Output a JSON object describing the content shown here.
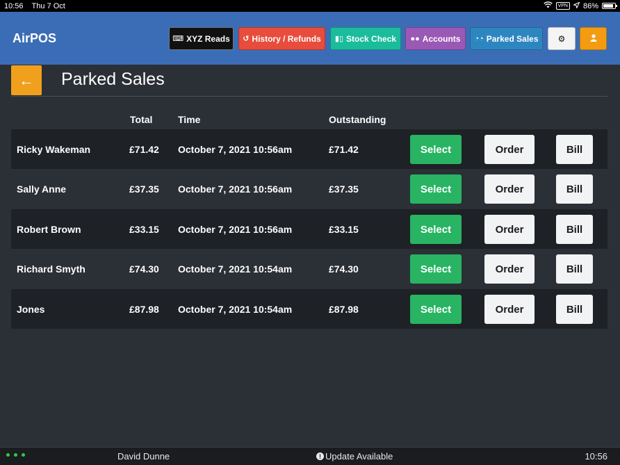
{
  "status_bar": {
    "time": "10:56",
    "date": "Thu 7 Oct",
    "vpn": "VPN",
    "battery": "86%",
    "battery_level": 0.86
  },
  "header": {
    "brand": "AirPOS",
    "nav": {
      "xyz_reads": "XYZ Reads",
      "history_refunds": "History / Refunds",
      "stock_check": "Stock Check",
      "accounts": "Accounts",
      "parked_sales": "Parked Sales"
    }
  },
  "page": {
    "back_icon": "arrow-left-icon",
    "title": "Parked Sales"
  },
  "table": {
    "headers": {
      "name": "",
      "total": "Total",
      "time": "Time",
      "outstanding": "Outstanding"
    },
    "rows": [
      {
        "name": "Ricky Wakeman",
        "total": "£71.42",
        "time": "October 7, 2021 10:56am",
        "outstanding": "£71.42",
        "select": "Select",
        "order": "Order",
        "bill": "Bill"
      },
      {
        "name": "Sally Anne",
        "total": "£37.35",
        "time": "October 7, 2021 10:56am",
        "outstanding": "£37.35",
        "select": "Select",
        "order": "Order",
        "bill": "Bill"
      },
      {
        "name": "Robert Brown",
        "total": "£33.15",
        "time": "October 7, 2021 10:56am",
        "outstanding": "£33.15",
        "select": "Select",
        "order": "Order",
        "bill": "Bill"
      },
      {
        "name": "Richard Smyth",
        "total": "£74.30",
        "time": "October 7, 2021 10:54am",
        "outstanding": "£74.30",
        "select": "Select",
        "order": "Order",
        "bill": "Bill"
      },
      {
        "name": "Jones",
        "total": "£87.98",
        "time": "October 7, 2021 10:54am",
        "outstanding": "£87.98",
        "select": "Select",
        "order": "Order",
        "bill": "Bill"
      }
    ]
  },
  "footer": {
    "user": "David Dunne",
    "update": "Update Available",
    "time": "10:56"
  },
  "colors": {
    "header_bg": "#3b6db6",
    "xyz_reads": "#111111",
    "history_refunds": "#e74c3c",
    "stock_check": "#1abc9c",
    "accounts": "#9b59b6",
    "parked_sales": "#2e86c1",
    "accent_orange": "#f39c12",
    "select_green": "#28b463"
  }
}
